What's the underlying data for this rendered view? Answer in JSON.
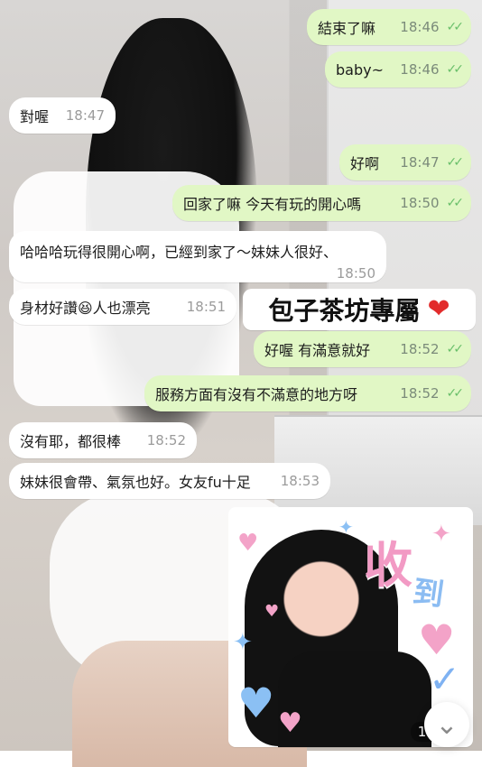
{
  "messages": [
    {
      "id": "m1",
      "side": "out",
      "text": "結束了嘛",
      "time": "18:46",
      "ticks": "✓✓"
    },
    {
      "id": "m2",
      "side": "out",
      "text": "baby~",
      "time": "18:46",
      "ticks": "✓✓"
    },
    {
      "id": "m3",
      "side": "in",
      "text": "對喔",
      "time": "18:47"
    },
    {
      "id": "m4",
      "side": "out",
      "text": "好啊",
      "time": "18:47",
      "ticks": "✓✓"
    },
    {
      "id": "m5",
      "side": "out",
      "text": "回家了嘛 今天有玩的開心嗎",
      "time": "18:50",
      "ticks": "✓✓"
    },
    {
      "id": "m6",
      "side": "in",
      "text": "哈哈哈玩得很開心啊，已經到家了～妹妹人很好、",
      "time": "18:50"
    },
    {
      "id": "m7",
      "side": "in",
      "text": "身材好讚😆人也漂亮",
      "time": "18:51"
    },
    {
      "id": "m8",
      "side": "out",
      "text": "好喔 有滿意就好",
      "time": "18:52",
      "ticks": "✓✓"
    },
    {
      "id": "m9",
      "side": "out",
      "text": "服務方面有沒有不滿意的地方呀",
      "time": "18:52",
      "ticks": "✓✓"
    },
    {
      "id": "m10",
      "side": "in",
      "text": "沒有耶，都很棒",
      "time": "18:52"
    },
    {
      "id": "m11",
      "side": "in",
      "text": "妹妹很會帶、氣氛也好。女友fu十足",
      "time": "18:53"
    }
  ],
  "label": {
    "text": "包子茶坊專屬",
    "heart": "❤"
  },
  "sticker": {
    "text_big": "收",
    "text_small": "到",
    "time": "18:53"
  },
  "ui": {
    "scroll_down_icon": "chevron-down-icon",
    "scroll_down_glyph": "⌄"
  },
  "colors": {
    "outgoing_bubble": "#e1f7c5",
    "incoming_bubble": "#ffffff",
    "tick": "#69bf6a"
  }
}
